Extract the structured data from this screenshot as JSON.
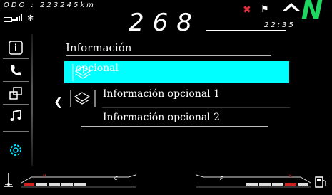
{
  "status": {
    "odometer_label": "ODO : 223245km",
    "speed": "268",
    "clock": "22:35",
    "gear": "N",
    "gear_color": "#1ed760",
    "warning_color": "#e0303a"
  },
  "icons": [
    "battery-icon",
    "signal-icon",
    "bluetooth-icon",
    "warning-icon",
    "rider-icon",
    "up-arrow-icon"
  ],
  "sidebar": {
    "items": [
      {
        "icon": "info-icon"
      },
      {
        "icon": "phone-icon"
      },
      {
        "icon": "screens-icon"
      },
      {
        "icon": "music-icon"
      },
      {
        "icon": "settings-icon"
      }
    ]
  },
  "menu": {
    "title": "Información",
    "selected_label": "opcional",
    "items": [
      {
        "label": "Información opcional 1"
      },
      {
        "label": "Información opcional 2"
      }
    ],
    "highlight_color": "#00ffff"
  },
  "gauges": {
    "left_label": "C",
    "right_label": "F",
    "left_marker": "H",
    "right_marker": "E"
  }
}
